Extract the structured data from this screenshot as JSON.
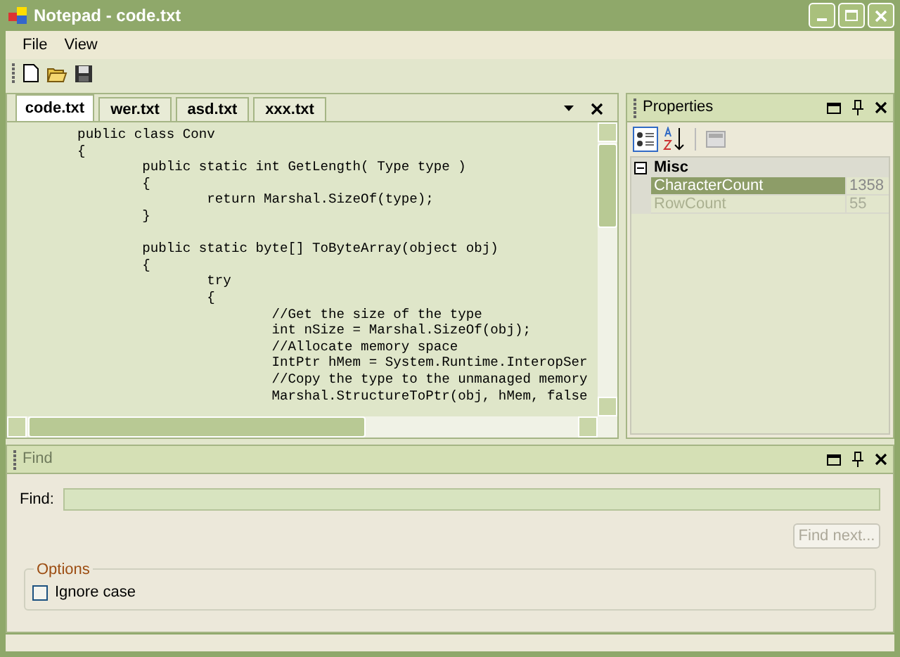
{
  "window": {
    "title": "Notepad - code.txt"
  },
  "menu": [
    {
      "label": "File"
    },
    {
      "label": "View"
    }
  ],
  "tabs": [
    {
      "label": "code.txt",
      "selected": true
    },
    {
      "label": "wer.txt",
      "selected": false
    },
    {
      "label": "asd.txt",
      "selected": false
    },
    {
      "label": "xxx.txt",
      "selected": false
    }
  ],
  "editor": {
    "lines": [
      {
        "text": "        public class Conv",
        "blank_before": false
      },
      {
        "text": "        {",
        "blank_before": false
      },
      {
        "text": "                public static int GetLength( Type type )",
        "blank_before": false
      },
      {
        "text": "                {",
        "blank_before": false
      },
      {
        "text": "                        return Marshal.SizeOf(type);",
        "blank_before": false
      },
      {
        "text": "                }",
        "blank_before": false
      },
      {
        "text": "                public static byte[] ToByteArray(object obj)",
        "blank_before": true
      },
      {
        "text": "                {",
        "blank_before": false
      },
      {
        "text": "                        try",
        "blank_before": false
      },
      {
        "text": "                        {",
        "blank_before": false
      },
      {
        "text": "                                //Get the size of the type",
        "blank_before": false
      },
      {
        "text": "                                int nSize = Marshal.SizeOf(obj);",
        "blank_before": false
      },
      {
        "text": "                                //Allocate memory space",
        "blank_before": false
      },
      {
        "text": "                                IntPtr hMem = System.Runtime.InteropSer",
        "blank_before": false
      },
      {
        "text": "                                //Copy the type to the unmanaged memory",
        "blank_before": false
      },
      {
        "text": "                                Marshal.StructureToPtr(obj, hMem, false",
        "blank_before": false
      }
    ]
  },
  "properties": {
    "title": "Properties",
    "category": "Misc",
    "expanded": true,
    "rows": [
      {
        "name": "CharacterCount",
        "value": "1358",
        "selected": true,
        "disabled": false
      },
      {
        "name": "RowCount",
        "value": "55",
        "selected": false,
        "disabled": true
      }
    ]
  },
  "find": {
    "title": "Find",
    "label": "Find:",
    "button": {
      "label": "Find next...",
      "disabled": true
    },
    "options": {
      "title": "Options",
      "checkbox": {
        "label": "Ignore case",
        "checked": false
      }
    }
  }
}
